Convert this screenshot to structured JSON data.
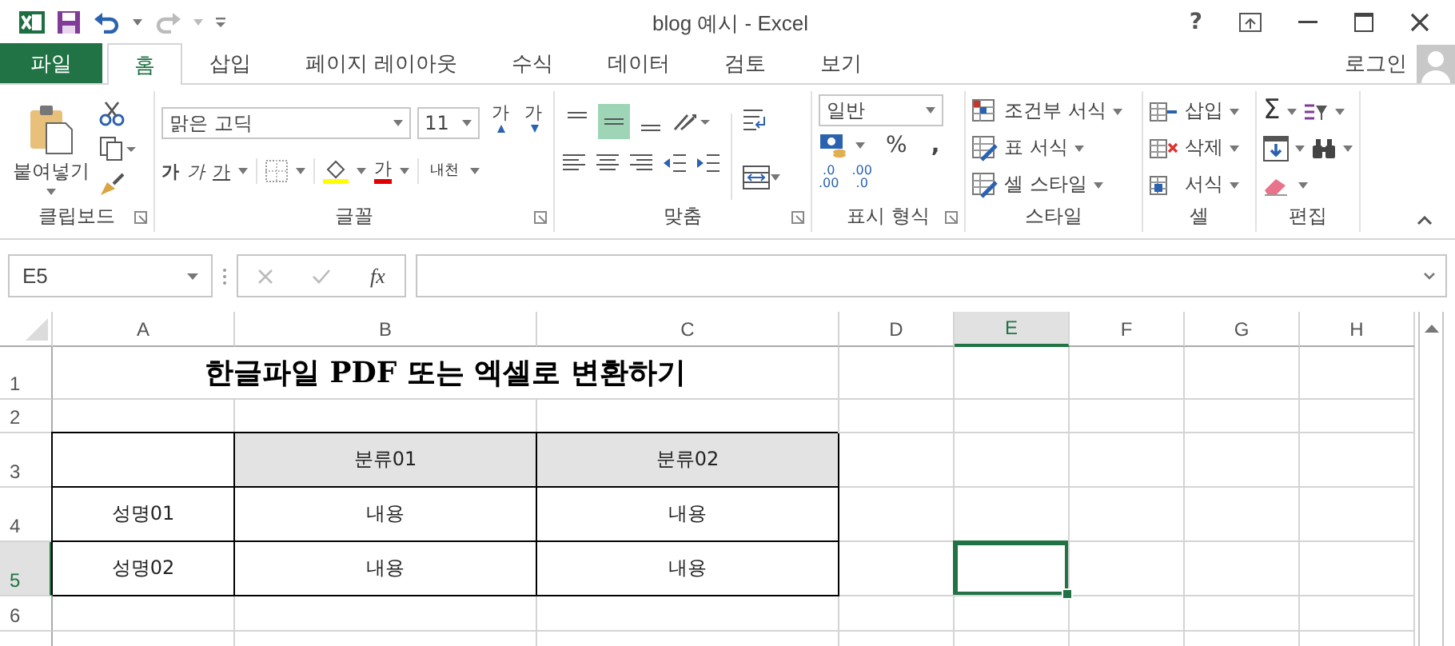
{
  "title_bar": {
    "title": "blog 예시 - Excel",
    "help": "?"
  },
  "tabs": [
    {
      "label": "파일",
      "kind": "file",
      "selected": false
    },
    {
      "label": "홈",
      "kind": "tab",
      "selected": true
    },
    {
      "label": "삽입",
      "kind": "tab",
      "selected": false
    },
    {
      "label": "페이지 레이아웃",
      "kind": "tab",
      "selected": false
    },
    {
      "label": "수식",
      "kind": "tab",
      "selected": false
    },
    {
      "label": "데이터",
      "kind": "tab",
      "selected": false
    },
    {
      "label": "검토",
      "kind": "tab",
      "selected": false
    },
    {
      "label": "보기",
      "kind": "tab",
      "selected": false
    }
  ],
  "account": {
    "label": "로그인"
  },
  "ribbon": {
    "clipboard": {
      "paste": "붙여넣기",
      "label": "클립보드"
    },
    "font": {
      "name": "맑은 고딕",
      "size": "11",
      "grow": "가",
      "shrink": "가",
      "bold": "가",
      "italic": "가",
      "underline": "가",
      "text_color": "가",
      "phonetic": "내천",
      "label": "글꼴"
    },
    "alignment": {
      "vertical": [
        {
          "selected": false
        },
        {
          "selected": true
        },
        {
          "selected": false
        }
      ],
      "label": "맞춤"
    },
    "number": {
      "format": "일반",
      "percent": "%",
      "comma": ",",
      "decimals": [
        {
          "top": ".0",
          "bottom": ".00"
        },
        {
          "top": ".00",
          "bottom": ".0"
        }
      ],
      "label": "표시 형식"
    },
    "styles": {
      "items": [
        "조건부 서식",
        "표 서식",
        "셀 스타일"
      ],
      "label": "스타일"
    },
    "cells": {
      "items": [
        "삽입",
        "삭제",
        "서식"
      ],
      "label": "셀"
    },
    "editing": {
      "sum": "Σ",
      "label": "편집"
    }
  },
  "formula_bar": {
    "name_box": "E5",
    "fx": "fx"
  },
  "sheet": {
    "columns": [
      {
        "label": "A",
        "selected": false
      },
      {
        "label": "B",
        "selected": false
      },
      {
        "label": "C",
        "selected": false
      },
      {
        "label": "D",
        "selected": false
      },
      {
        "label": "E",
        "selected": true
      },
      {
        "label": "F",
        "selected": false
      },
      {
        "label": "G",
        "selected": false
      },
      {
        "label": "H",
        "selected": false
      }
    ],
    "rows": [
      {
        "number": "1",
        "selected": false,
        "cells": [
          {
            "kind": "title",
            "text": "한글파일 PDF 또는 엑셀로 변환하기"
          }
        ]
      },
      {
        "number": "2",
        "selected": false
      },
      {
        "number": "3",
        "selected": false,
        "cells": [
          {
            "kind": "cell",
            "bordered": true,
            "shaded": false
          },
          {
            "kind": "cell",
            "text": "분류01",
            "bordered": true,
            "shaded": true
          },
          {
            "kind": "cell",
            "text": "분류02",
            "bordered": true,
            "shaded": true
          }
        ]
      },
      {
        "number": "4",
        "selected": false,
        "cells": [
          {
            "kind": "cell",
            "text": "성명01",
            "bordered": true,
            "shaded": false
          },
          {
            "kind": "cell",
            "text": "내용",
            "bordered": true,
            "shaded": false
          },
          {
            "kind": "cell",
            "text": "내용",
            "bordered": true,
            "shaded": false
          }
        ]
      },
      {
        "number": "5",
        "selected": true,
        "cells": [
          {
            "kind": "cell",
            "text": "성명02",
            "bordered": true,
            "shaded": false
          },
          {
            "kind": "cell",
            "text": "내용",
            "bordered": true,
            "shaded": false
          },
          {
            "kind": "cell",
            "text": "내용",
            "bordered": true,
            "shaded": false
          }
        ]
      },
      {
        "number": "6",
        "selected": false
      }
    ]
  }
}
